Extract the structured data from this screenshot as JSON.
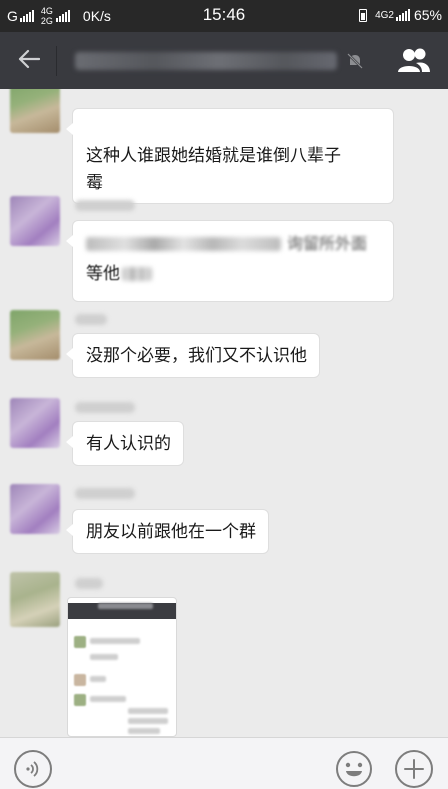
{
  "status_bar": {
    "carrier_1": "G",
    "net_top": "4G",
    "net_bottom": "2G",
    "speed": "0K/s",
    "time": "15:46",
    "net_right": "4G2",
    "battery": "65%"
  },
  "title_bar": {
    "back_icon": "back-arrow-icon",
    "muted_icon": "muted-bell-icon",
    "group_icon": "group-members-icon"
  },
  "messages": [
    {
      "text": "这种人谁跟她结婚就是谁倒八辈子\n霉"
    },
    {
      "blurred_line": "询留所外面",
      "line2": "等他"
    },
    {
      "text": "没那个必要，我们又不认识他"
    },
    {
      "text": "有人认识的"
    },
    {
      "text": "朋友以前跟他在一个群"
    }
  ],
  "input_bar": {
    "voice_icon": "voice-icon",
    "emoji_icon": "emoji-icon",
    "plus_icon": "plus-icon"
  }
}
